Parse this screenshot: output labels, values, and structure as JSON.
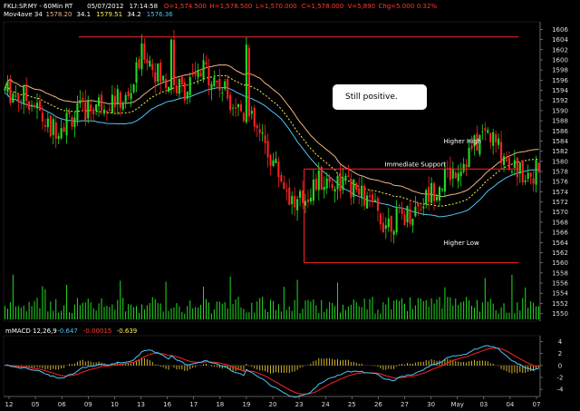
{
  "header": {
    "line1": [
      {
        "text": "FKLI:SP.MY - 60Min RT",
        "color": "#ffffff"
      },
      {
        "text": "05/07/2012",
        "color": "#ffffff"
      },
      {
        "text": "17:14:58",
        "color": "#ffffff"
      },
      {
        "text": "O=1,574.500",
        "color": "#ff3b30"
      },
      {
        "text": "H=1,578.500",
        "color": "#ff3b30"
      },
      {
        "text": "L=1,570.000",
        "color": "#ff3b30"
      },
      {
        "text": "C=1,578.000",
        "color": "#ff3b30"
      },
      {
        "text": "V=5,890",
        "color": "#ff3b30"
      },
      {
        "text": "Chg=5.000",
        "color": "#ff3b30"
      },
      {
        "text": "0.32%",
        "color": "#ff3b30"
      }
    ],
    "line2": [
      {
        "text": "Mov4ave 34",
        "color": "#ffffff"
      },
      {
        "text": "1578.20",
        "color": "#f4b183"
      },
      {
        "text": "34.1",
        "color": "#ffffff"
      },
      {
        "text": "1579.51",
        "color": "#ffee55"
      },
      {
        "text": "34.2",
        "color": "#ffffff"
      },
      {
        "text": "1576.36",
        "color": "#4fc3f7"
      }
    ]
  },
  "callout": {
    "text": "Still positive."
  },
  "colors": {
    "up": "#22dd22",
    "down": "#ff2222",
    "volume": "#22dd22",
    "ma_high": "#f4b183",
    "ma_close": "#ffee55",
    "ma_low": "#4fc3f7",
    "level": "#ff2222",
    "macd": "#4fc3f7",
    "signal": "#ff2222",
    "hist": "#e8c830",
    "axis": "#999999"
  },
  "chart_data": [
    {
      "type": "candlestick",
      "yticks": [
        1550,
        1552,
        1554,
        1556,
        1558,
        1560,
        1562,
        1564,
        1566,
        1568,
        1570,
        1572,
        1574,
        1576,
        1578,
        1580,
        1582,
        1584,
        1586,
        1588,
        1590,
        1592,
        1594,
        1596,
        1598,
        1600,
        1602,
        1604,
        1606
      ],
      "ylim": [
        1548.5,
        1607.5
      ],
      "xtick_labels": [
        "12",
        "05",
        "06",
        "09",
        "10",
        "13",
        "16",
        "17",
        "18",
        "19",
        "20",
        "23",
        "24",
        "25",
        "26",
        "27",
        "30",
        "May",
        "03",
        "04",
        "07"
      ],
      "levels": [
        {
          "y": 1604.5,
          "x_from": 0.14,
          "x_to": 0.96
        },
        {
          "y": 1578.5,
          "x_from": 0.56,
          "x_to": 0.96
        },
        {
          "y": 1560.0,
          "x_from": 0.56,
          "x_to": 0.96
        }
      ],
      "annotations": [
        {
          "text": "Higher High",
          "x": 0.82,
          "y": 1583.5
        },
        {
          "text": "Immediate Support",
          "x": 0.71,
          "y": 1579.0
        },
        {
          "text": "Higher Low",
          "x": 0.82,
          "y": 1563.5
        }
      ]
    },
    {
      "type": "bar",
      "name": "Volume"
    },
    {
      "type": "macd",
      "label": [
        {
          "text": "mMACD 12,26,9",
          "color": "#ffffff"
        },
        {
          "text": "-0.647",
          "color": "#4fc3f7"
        },
        {
          "text": "-0.00015",
          "color": "#ff3b30"
        },
        {
          "text": "-0.639",
          "color": "#ffee55"
        }
      ],
      "yticks": [
        4,
        2,
        0,
        -2,
        -4
      ],
      "ylim": [
        -5.2,
        5.0
      ]
    }
  ]
}
